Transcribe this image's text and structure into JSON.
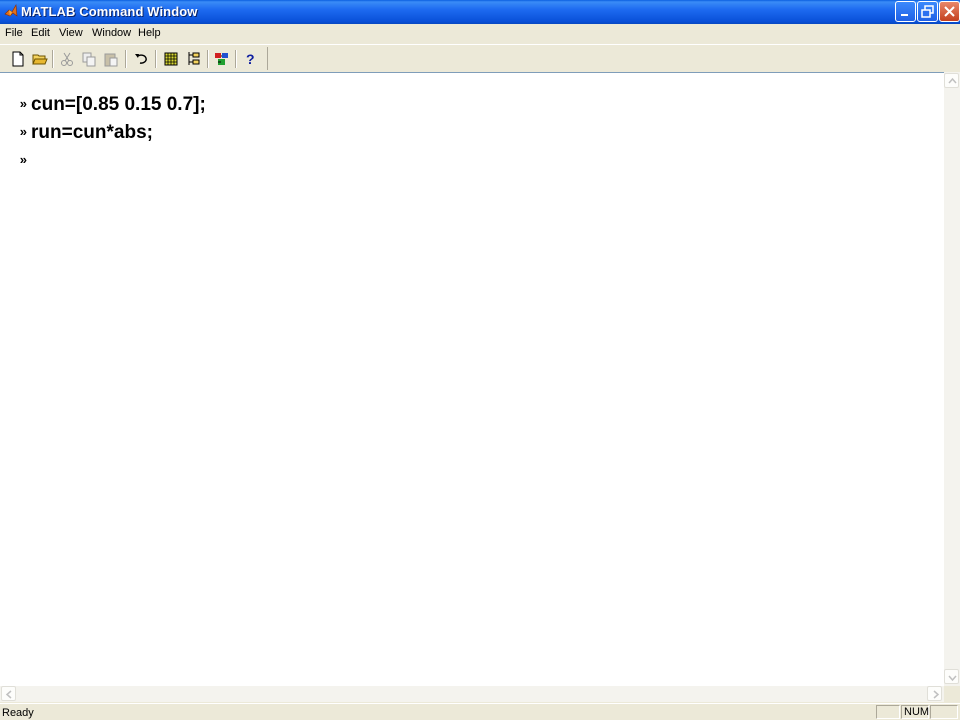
{
  "window": {
    "title": "MATLAB Command Window",
    "icon": "matlab-logo-icon"
  },
  "menu": {
    "items": [
      "File",
      "Edit",
      "View",
      "Window",
      "Help"
    ]
  },
  "toolbar": {
    "buttons": [
      {
        "name": "new-file-icon"
      },
      {
        "name": "open-folder-icon"
      },
      {
        "name": "cut-icon",
        "enabled": false
      },
      {
        "name": "copy-icon",
        "enabled": false
      },
      {
        "name": "paste-icon",
        "enabled": false
      },
      {
        "name": "undo-icon"
      },
      {
        "name": "workspace-browser-icon"
      },
      {
        "name": "path-browser-icon"
      },
      {
        "name": "simulink-icon"
      },
      {
        "name": "help-icon"
      }
    ]
  },
  "console": {
    "prompt": "»",
    "lines": [
      "cun=[0.85 0.15 0.7];",
      "run=cun*abs;",
      ""
    ]
  },
  "status": {
    "text": "Ready",
    "num_indicator": "NUM"
  },
  "colors": {
    "titlebar": "#0a5fe0",
    "chrome": "#ece9d8",
    "console_bg": "#ffffff",
    "close_button": "#c4401f"
  }
}
